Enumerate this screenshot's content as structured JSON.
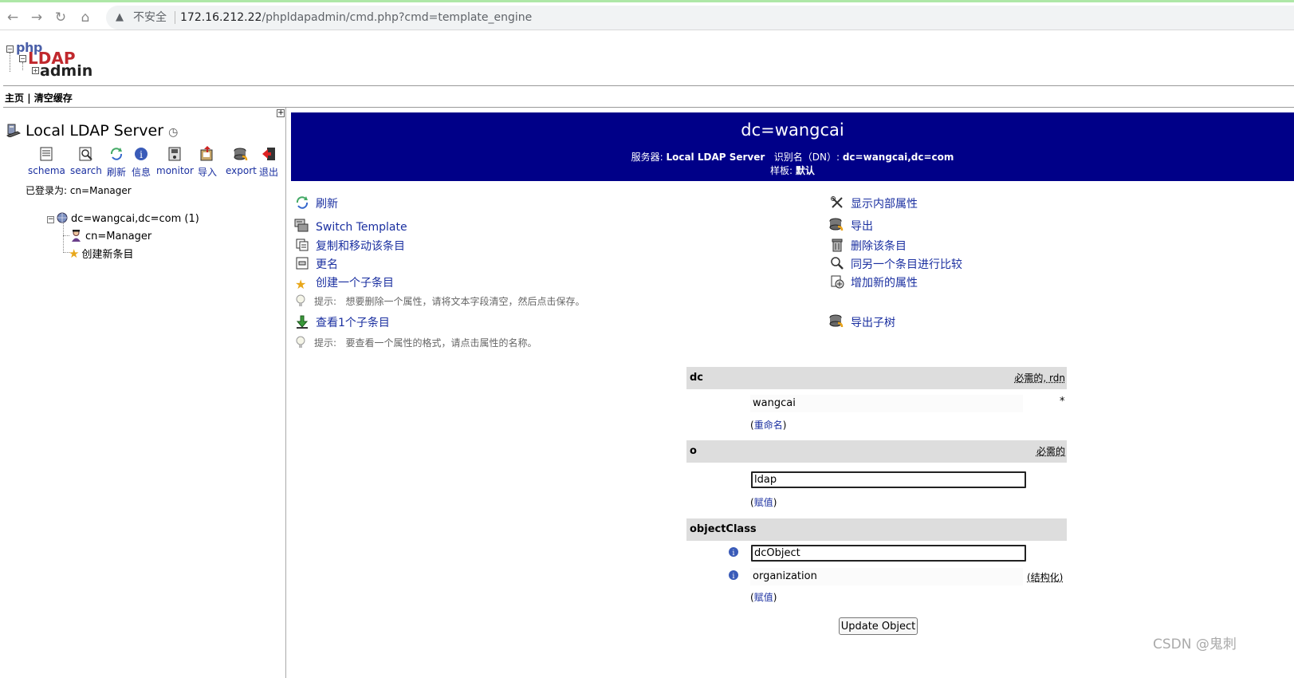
{
  "browser": {
    "insecure_label": "不安全",
    "url_host": "172.16.212.22",
    "url_path": "/phpldapadmin/cmd.php?cmd=template_engine"
  },
  "logo": {
    "php": "php",
    "ldap": "LDAP",
    "admin": "admin"
  },
  "top_menu": {
    "home": "主页",
    "separator": "|",
    "clear_cache": "清空缓存"
  },
  "left": {
    "server_name": "Local LDAP Server",
    "toolbar": [
      {
        "label": "schema",
        "icon": "schema-icon"
      },
      {
        "label": "search",
        "icon": "search-icon"
      },
      {
        "label": "刷新",
        "icon": "refresh-icon"
      },
      {
        "label": "信息",
        "icon": "info-icon"
      },
      {
        "label": "monitor",
        "icon": "monitor-icon"
      },
      {
        "label": "导入",
        "icon": "import-icon"
      },
      {
        "label": "export",
        "icon": "export-icon"
      },
      {
        "label": "退出",
        "icon": "logout-icon"
      }
    ],
    "logged_in_as": "已登录为: cn=Manager",
    "tree": {
      "root": "dc=wangcai,dc=com (1)",
      "children": [
        "cn=Manager",
        "创建新条目"
      ]
    }
  },
  "header": {
    "title": "dc=wangcai",
    "server_label": "服务器:",
    "server_value": "Local LDAP Server",
    "dn_label": "识别名（DN）:",
    "dn_value": "dc=wangcai,dc=com",
    "template_label": "样板:",
    "template_value": "默认"
  },
  "actions_left": [
    {
      "label": "刷新",
      "icon": "refresh-icon"
    },
    {
      "label": "Switch Template",
      "icon": "switch-template-icon"
    },
    {
      "label": "复制和移动该条目",
      "icon": "copy-icon"
    },
    {
      "label": "更名",
      "icon": "rename-icon"
    },
    {
      "label": "创建一个子条目",
      "icon": "star-icon"
    }
  ],
  "hint1": {
    "label": "提示:",
    "text": "想要删除一个属性，请将文本字段清空，然后点击保存。"
  },
  "view_children": {
    "label": "查看1个子条目",
    "icon": "download-arrow-icon"
  },
  "hint2": {
    "label": "提示:",
    "text": "要查看一个属性的格式，请点击属性的名称。"
  },
  "actions_right": [
    {
      "label": "显示内部属性",
      "icon": "tools-icon"
    },
    {
      "label": "导出",
      "icon": "export-icon"
    },
    {
      "label": "删除该条目",
      "icon": "trash-icon"
    },
    {
      "label": "同另一个条目进行比较",
      "icon": "compare-icon"
    },
    {
      "label": "增加新的属性",
      "icon": "add-attribute-icon"
    }
  ],
  "export_subtree": {
    "label": "导出子树",
    "icon": "export-icon"
  },
  "attributes": {
    "dc": {
      "name": "dc",
      "flags": "必需的, rdn",
      "value": "wangcai",
      "marker": "*",
      "link": "重命名"
    },
    "o": {
      "name": "o",
      "flags": "必需的",
      "value": "ldap",
      "link": "赋值"
    },
    "objectClass": {
      "name": "objectClass",
      "value1": "dcObject",
      "value2": "organization",
      "structural": "(结构化)",
      "link": "赋值"
    }
  },
  "update_button": "Update Object",
  "watermark": "CSDN @鬼刺"
}
